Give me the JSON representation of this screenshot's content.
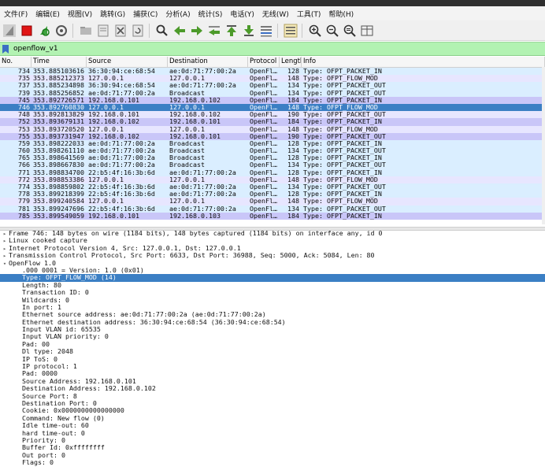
{
  "menu": [
    "文件(F)",
    "编辑(E)",
    "视图(V)",
    "跳转(G)",
    "捕获(C)",
    "分析(A)",
    "统计(S)",
    "电话(Y)",
    "无线(W)",
    "工具(T)",
    "帮助(H)"
  ],
  "toolbar_icons": [
    "start-capture-icon",
    "stop-capture-icon",
    "restart-capture-icon",
    "capture-options-icon",
    "open-file-icon",
    "save-file-icon",
    "close-file-icon",
    "reload-file-icon",
    "find-packet-icon",
    "go-back-icon",
    "go-forward-icon",
    "go-to-packet-icon",
    "go-first-icon",
    "go-last-icon",
    "auto-scroll-icon",
    "colorize-icon",
    "zoom-in-icon",
    "zoom-out-icon",
    "zoom-normal-icon",
    "resize-columns-icon"
  ],
  "filter": {
    "value": "openflow_v1"
  },
  "columns": [
    "No.",
    "Time",
    "Source",
    "Destination",
    "Protocol",
    "Length",
    "Info"
  ],
  "packets": [
    {
      "no": "734",
      "time": "353.885103616",
      "src": "36:30:94:ce:68:54",
      "dst": "ae:0d:71:77:00:2a",
      "proto": "OpenFl…",
      "len": "128",
      "info": "Type: OFPT_PACKET_IN",
      "style": "blue"
    },
    {
      "no": "735",
      "time": "353.885212373",
      "src": "127.0.0.1",
      "dst": "127.0.0.1",
      "proto": "OpenFl…",
      "len": "148",
      "info": "Type: OFPT_FLOW_MOD",
      "style": "tcp"
    },
    {
      "no": "737",
      "time": "353.885234898",
      "src": "36:30:94:ce:68:54",
      "dst": "ae:0d:71:77:00:2a",
      "proto": "OpenFl…",
      "len": "134",
      "info": "Type: OFPT_PACKET_OUT",
      "style": "blue"
    },
    {
      "no": "739",
      "time": "353.885256852",
      "src": "ae:0d:71:77:00:2a",
      "dst": "Broadcast",
      "proto": "OpenFl…",
      "len": "134",
      "info": "Type: OFPT_PACKET_OUT",
      "style": "blue"
    },
    {
      "no": "745",
      "time": "353.892726571",
      "src": "192.168.0.101",
      "dst": "192.168.0.102",
      "proto": "OpenFl…",
      "len": "184",
      "info": "Type: OFPT_PACKET_IN",
      "style": "lav"
    },
    {
      "no": "746",
      "time": "353.892760830",
      "src": "127.0.0.1",
      "dst": "127.0.0.1",
      "proto": "OpenFl…",
      "len": "148",
      "info": "Type: OFPT_FLOW_MOD",
      "style": "sel"
    },
    {
      "no": "748",
      "time": "353.892813829",
      "src": "192.168.0.101",
      "dst": "192.168.0.102",
      "proto": "OpenFl…",
      "len": "190",
      "info": "Type: OFPT_PACKET_OUT",
      "style": "tcp"
    },
    {
      "no": "752",
      "time": "353.893679131",
      "src": "192.168.0.102",
      "dst": "192.168.0.101",
      "proto": "OpenFl…",
      "len": "184",
      "info": "Type: OFPT_PACKET_IN",
      "style": "lav"
    },
    {
      "no": "753",
      "time": "353.893720520",
      "src": "127.0.0.1",
      "dst": "127.0.0.1",
      "proto": "OpenFl…",
      "len": "148",
      "info": "Type: OFPT_FLOW_MOD",
      "style": "tcp"
    },
    {
      "no": "755",
      "time": "353.893731947",
      "src": "192.168.0.102",
      "dst": "192.168.0.101",
      "proto": "OpenFl…",
      "len": "190",
      "info": "Type: OFPT_PACKET_OUT",
      "style": "lav"
    },
    {
      "no": "759",
      "time": "353.898222033",
      "src": "ae:0d:71:77:00:2a",
      "dst": "Broadcast",
      "proto": "OpenFl…",
      "len": "128",
      "info": "Type: OFPT_PACKET_IN",
      "style": "blue"
    },
    {
      "no": "760",
      "time": "353.898261110",
      "src": "ae:0d:71:77:00:2a",
      "dst": "Broadcast",
      "proto": "OpenFl…",
      "len": "134",
      "info": "Type: OFPT_PACKET_OUT",
      "style": "blue"
    },
    {
      "no": "765",
      "time": "353.898641569",
      "src": "ae:0d:71:77:00:2a",
      "dst": "Broadcast",
      "proto": "OpenFl…",
      "len": "128",
      "info": "Type: OFPT_PACKET_IN",
      "style": "blue"
    },
    {
      "no": "766",
      "time": "353.898667830",
      "src": "ae:0d:71:77:00:2a",
      "dst": "Broadcast",
      "proto": "OpenFl…",
      "len": "134",
      "info": "Type: OFPT_PACKET_OUT",
      "style": "blue"
    },
    {
      "no": "771",
      "time": "353.898834700",
      "src": "22:b5:4f:16:3b:6d",
      "dst": "ae:0d:71:77:00:2a",
      "proto": "OpenFl…",
      "len": "128",
      "info": "Type: OFPT_PACKET_IN",
      "style": "blue"
    },
    {
      "no": "772",
      "time": "353.898853386",
      "src": "127.0.0.1",
      "dst": "127.0.0.1",
      "proto": "OpenFl…",
      "len": "148",
      "info": "Type: OFPT_FLOW_MOD",
      "style": "tcp"
    },
    {
      "no": "774",
      "time": "353.898859802",
      "src": "22:b5:4f:16:3b:6d",
      "dst": "ae:0d:71:77:00:2a",
      "proto": "OpenFl…",
      "len": "134",
      "info": "Type: OFPT_PACKET_OUT",
      "style": "blue"
    },
    {
      "no": "778",
      "time": "353.899218399",
      "src": "22:b5:4f:16:3b:6d",
      "dst": "ae:0d:71:77:00:2a",
      "proto": "OpenFl…",
      "len": "128",
      "info": "Type: OFPT_PACKET_IN",
      "style": "blue"
    },
    {
      "no": "779",
      "time": "353.899240584",
      "src": "127.0.0.1",
      "dst": "127.0.0.1",
      "proto": "OpenFl…",
      "len": "148",
      "info": "Type: OFPT_FLOW_MOD",
      "style": "tcp"
    },
    {
      "no": "781",
      "time": "353.899247696",
      "src": "22:b5:4f:16:3b:6d",
      "dst": "ae:0d:71:77:00:2a",
      "proto": "OpenFl…",
      "len": "134",
      "info": "Type: OFPT_PACKET_OUT",
      "style": "blue"
    },
    {
      "no": "785",
      "time": "353.899549059",
      "src": "192.168.0.101",
      "dst": "192.168.0.103",
      "proto": "OpenFl…",
      "len": "184",
      "info": "Type: OFPT_PACKET_IN",
      "style": "lav"
    }
  ],
  "details": [
    {
      "text": "Frame 746: 148 bytes on wire (1184 bits), 148 bytes captured (1184 bits) on interface any, id 0",
      "indent": 0,
      "arrow": "right",
      "sel": false
    },
    {
      "text": "Linux cooked capture",
      "indent": 0,
      "arrow": "right",
      "sel": false
    },
    {
      "text": "Internet Protocol Version 4, Src: 127.0.0.1, Dst: 127.0.0.1",
      "indent": 0,
      "arrow": "right",
      "sel": false
    },
    {
      "text": "Transmission Control Protocol, Src Port: 6633, Dst Port: 36988, Seq: 5000, Ack: 5084, Len: 80",
      "indent": 0,
      "arrow": "right",
      "sel": false
    },
    {
      "text": "OpenFlow 1.0",
      "indent": 0,
      "arrow": "down",
      "sel": false
    },
    {
      "text": ".000 0001 = Version: 1.0 (0x01)",
      "indent": 1,
      "arrow": "",
      "sel": false
    },
    {
      "text": "Type: OFPT_FLOW_MOD (14)",
      "indent": 1,
      "arrow": "",
      "sel": true
    },
    {
      "text": "Length: 80",
      "indent": 1,
      "arrow": "",
      "sel": false
    },
    {
      "text": "Transaction ID: 0",
      "indent": 1,
      "arrow": "",
      "sel": false
    },
    {
      "text": "Wildcards: 0",
      "indent": 1,
      "arrow": "",
      "sel": false
    },
    {
      "text": "In port: 1",
      "indent": 1,
      "arrow": "",
      "sel": false
    },
    {
      "text": "Ethernet source address: ae:0d:71:77:00:2a (ae:0d:71:77:00:2a)",
      "indent": 1,
      "arrow": "",
      "sel": false
    },
    {
      "text": "Ethernet destination address: 36:30:94:ce:68:54 (36:30:94:ce:68:54)",
      "indent": 1,
      "arrow": "",
      "sel": false
    },
    {
      "text": "Input VLAN id: 65535",
      "indent": 1,
      "arrow": "",
      "sel": false
    },
    {
      "text": "Input VLAN priority: 0",
      "indent": 1,
      "arrow": "",
      "sel": false
    },
    {
      "text": "Pad: 00",
      "indent": 1,
      "arrow": "",
      "sel": false
    },
    {
      "text": "Dl type: 2048",
      "indent": 1,
      "arrow": "",
      "sel": false
    },
    {
      "text": "IP ToS: 0",
      "indent": 1,
      "arrow": "",
      "sel": false
    },
    {
      "text": "IP protocol: 1",
      "indent": 1,
      "arrow": "",
      "sel": false
    },
    {
      "text": "Pad: 0000",
      "indent": 1,
      "arrow": "",
      "sel": false
    },
    {
      "text": "Source Address: 192.168.0.101",
      "indent": 1,
      "arrow": "",
      "sel": false
    },
    {
      "text": "Destination Address: 192.168.0.102",
      "indent": 1,
      "arrow": "",
      "sel": false
    },
    {
      "text": "Source Port: 8",
      "indent": 1,
      "arrow": "",
      "sel": false
    },
    {
      "text": "Destination Port: 0",
      "indent": 1,
      "arrow": "",
      "sel": false
    },
    {
      "text": "Cookie: 0x0000000000000000",
      "indent": 1,
      "arrow": "",
      "sel": false
    },
    {
      "text": "Command: New flow (0)",
      "indent": 1,
      "arrow": "",
      "sel": false
    },
    {
      "text": "Idle time-out: 60",
      "indent": 1,
      "arrow": "",
      "sel": false
    },
    {
      "text": "hard time-out: 0",
      "indent": 1,
      "arrow": "",
      "sel": false
    },
    {
      "text": "Priority: 0",
      "indent": 1,
      "arrow": "",
      "sel": false
    },
    {
      "text": "Buffer Id: 0xffffffff",
      "indent": 1,
      "arrow": "",
      "sel": false
    },
    {
      "text": "Out port: 0",
      "indent": 1,
      "arrow": "",
      "sel": false
    },
    {
      "text": "Flags: 0",
      "indent": 1,
      "arrow": "",
      "sel": false
    }
  ]
}
